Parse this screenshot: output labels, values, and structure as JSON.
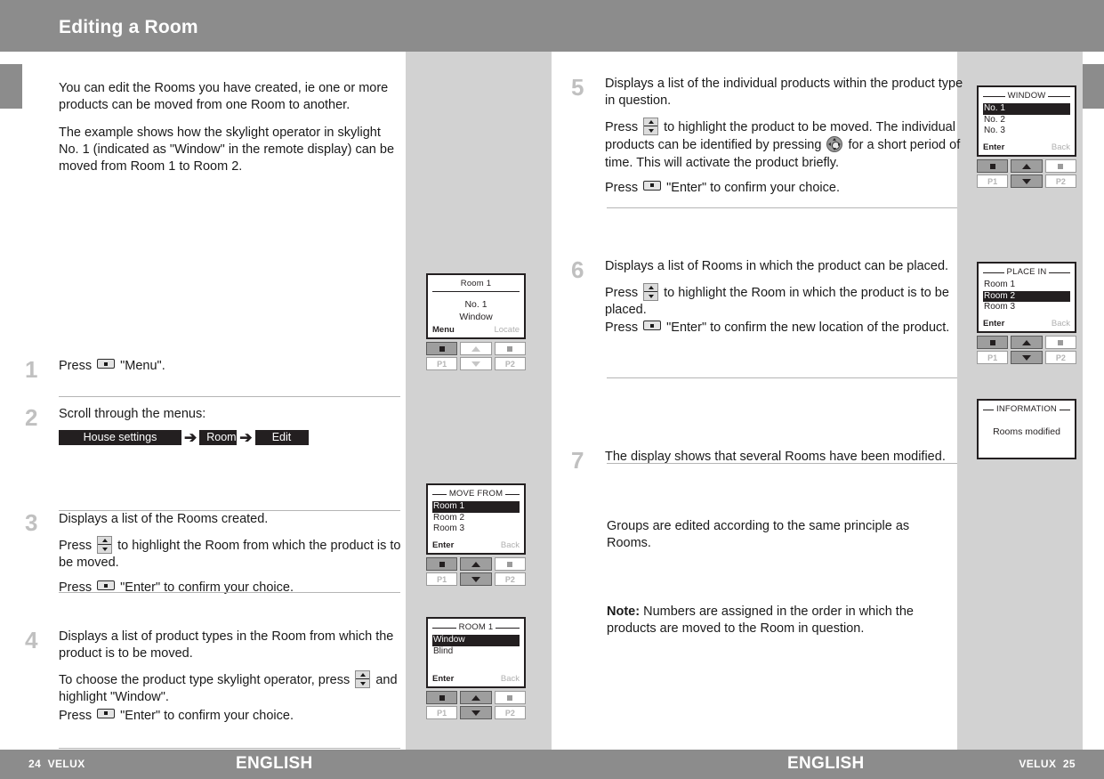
{
  "header": {
    "title": "Editing a Room"
  },
  "footer": {
    "left_page": "24",
    "left_brand": "VELUX",
    "lang_left": "ENGLISH",
    "lang_right": "ENGLISH",
    "right_brand": "VELUX",
    "right_page": "25"
  },
  "intro": {
    "p1": "You can edit the Rooms you have created, ie one or more products can be moved from one Room to another.",
    "p2": "The example shows how the skylight operator in skylight No. 1 (indicated as \"Window\" in the remote display) can be moved from Room 1 to Room 2."
  },
  "steps": {
    "s1": {
      "num": "1",
      "text_a": "Press",
      "text_b": "\"Menu\"."
    },
    "s2": {
      "num": "2",
      "text": "Scroll through the menus:",
      "crumbs": [
        "House settings",
        "Room",
        "Edit"
      ],
      "arrow": "➔"
    },
    "s3": {
      "num": "3",
      "p1": "Displays a list of the Rooms created.",
      "p2_a": "Press",
      "p2_b": "to highlight the Room from which the product is to be moved.",
      "p3_a": "Press",
      "p3_b": "\"Enter\" to confirm your choice."
    },
    "s4": {
      "num": "4",
      "p1": "Displays a list of product types in the Room from which the product is to be moved.",
      "p2_a": "To choose the product type skylight operator, press",
      "p2_b": "and highlight \"Window\".",
      "p3_a": "Press",
      "p3_b": "\"Enter\" to confirm your choice."
    },
    "s5": {
      "num": "5",
      "p1": "Displays a list of the individual products within the product type in question.",
      "p2_a": "Press",
      "p2_b": "to highlight the product to be moved. The individual products can be identified by pressing",
      "p2_c": "for a short period of time. This will activate the product briefly.",
      "p3_a": "Press",
      "p3_b": "\"Enter\" to confirm your choice."
    },
    "s6": {
      "num": "6",
      "p1": "Displays a list of Rooms in which the product can be placed.",
      "p2_a": "Press",
      "p2_b": "to highlight the Room in which the product is to be placed.",
      "p3_a": "Press",
      "p3_b": "\"Enter\" to confirm the new location of the product."
    },
    "s7": {
      "num": "7",
      "p1": "The display shows that several Rooms have been modified."
    }
  },
  "closing": {
    "groups": "Groups are edited according to the same principle as Rooms.",
    "note_label": "Note:",
    "note_text": " Numbers are assigned in the order in which the products are moved to the Room in question."
  },
  "displays": {
    "room1_status": {
      "title": "Room 1",
      "line1": "No. 1",
      "line2": "Window",
      "foot_left": "Menu",
      "foot_right": "Locate"
    },
    "move_from": {
      "title": "MOVE FROM",
      "rows": [
        "Room 1",
        "Room 2",
        "Room 3"
      ],
      "selected": 0,
      "foot_left": "Enter",
      "foot_right": "Back"
    },
    "room1_types": {
      "title": "ROOM 1",
      "rows": [
        "Window",
        "Blind"
      ],
      "selected": 0,
      "foot_left": "Enter",
      "foot_right": "Back"
    },
    "window_list": {
      "title": "WINDOW",
      "rows": [
        "No. 1",
        "No. 2",
        "No. 3"
      ],
      "selected": 0,
      "foot_left": "Enter",
      "foot_right": "Back"
    },
    "place_in": {
      "title": "PLACE IN",
      "rows": [
        "Room 1",
        "Room 2",
        "Room 3"
      ],
      "selected": 1,
      "foot_left": "Enter",
      "foot_right": "Back"
    },
    "information": {
      "title": "INFORMATION",
      "line1": "Rooms modified"
    }
  },
  "pad": {
    "p1": "P1",
    "p2": "P2"
  },
  "colors": {
    "band": "#8c8c8c",
    "gray_column": "#d2d2d2",
    "ink": "#231f20",
    "step_number": "#c0c0c0",
    "rule": "#b5b5b5"
  }
}
